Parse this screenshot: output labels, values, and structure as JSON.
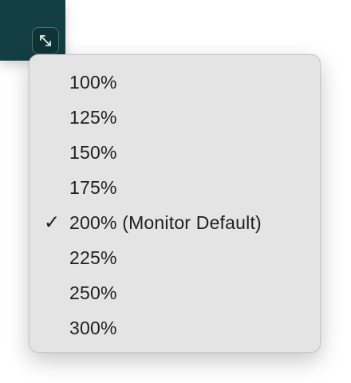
{
  "fullscreen_button": {
    "icon": "expand-arrows-icon"
  },
  "menu": {
    "items": [
      {
        "label": "100%",
        "checked": false
      },
      {
        "label": "125%",
        "checked": false
      },
      {
        "label": "150%",
        "checked": false
      },
      {
        "label": "175%",
        "checked": false
      },
      {
        "label": "200% (Monitor Default)",
        "checked": true
      },
      {
        "label": "225%",
        "checked": false
      },
      {
        "label": "250%",
        "checked": false
      },
      {
        "label": "300%",
        "checked": false
      }
    ],
    "check_glyph": "✓"
  },
  "colors": {
    "toolbar": "#133f42",
    "menu_background": "#e4e4e4",
    "text": "#1f1f1f"
  }
}
